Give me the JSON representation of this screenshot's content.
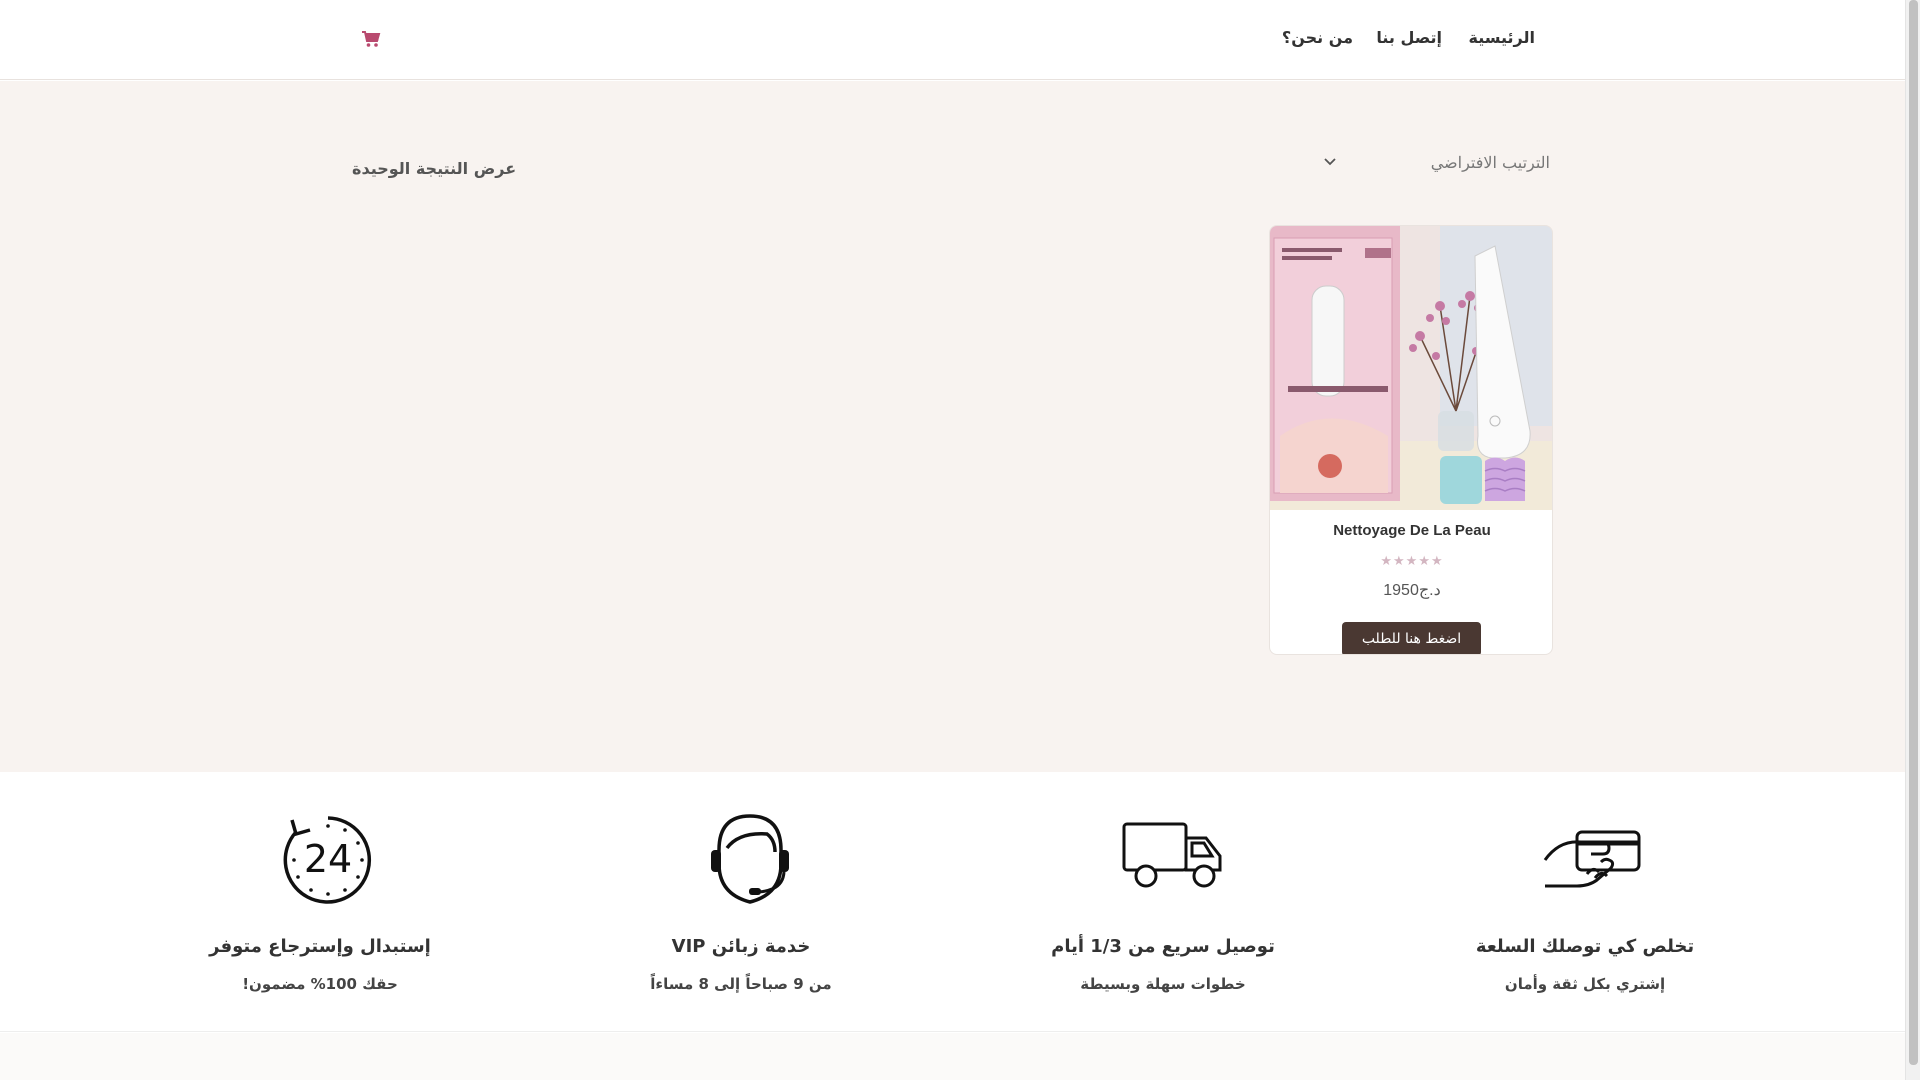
{
  "header": {
    "nav": {
      "home": "الرئيسية",
      "contact": "إتصل بنا",
      "about": "من نحن؟"
    },
    "icons": {
      "cart": "shopping-cart-icon"
    },
    "accent_color": "#b94a6f"
  },
  "shop": {
    "result_count": "عرض النتيجة الوحيدة",
    "sort": {
      "selected": "الترتيب الافتراضي"
    }
  },
  "product": {
    "title": "Nettoyage De La Peau",
    "rating": {
      "value": 0,
      "max": 5,
      "stars": "★★★★★"
    },
    "price": "1950د.ج",
    "order_button": "اضغط هنا للطلب",
    "image_alt": "product-photo"
  },
  "features": [
    {
      "icon": "card-payment-icon",
      "title": "تخلص كي توصلك السلعة",
      "desc": "إشتري بكل ثقة وأمان"
    },
    {
      "icon": "delivery-truck-icon",
      "title": "توصيل سريع من 1/3 أيام",
      "desc": "خطوات سهلة وبسيطة"
    },
    {
      "icon": "headset-support-icon",
      "title": "خدمة زبائن VIP",
      "desc": "من 9 صباحاً إلى 8 مساءاً"
    },
    {
      "icon": "24-hours-icon",
      "title": "إستبدال وإسترجاع متوفر",
      "desc": "حقك 100% مضمون!"
    }
  ],
  "colors": {
    "main_bg": "#f8f3f0",
    "button_bg": "#4a3832",
    "star_color": "#d3b6c1"
  },
  "icon_24": {
    "label": "24"
  }
}
